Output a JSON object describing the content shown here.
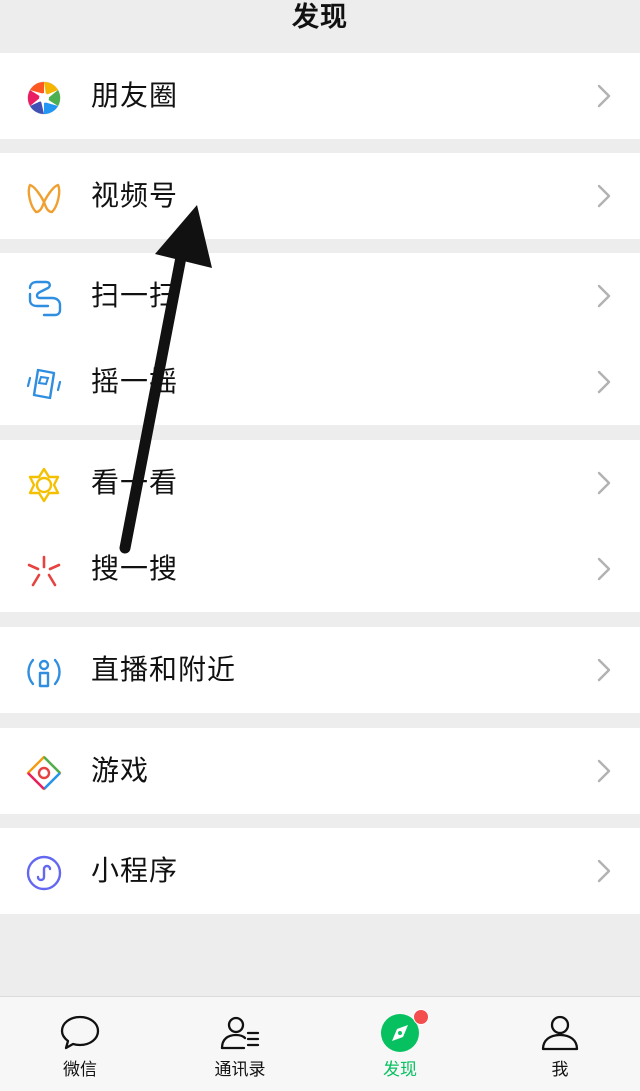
{
  "header": {
    "title": "发现"
  },
  "items": {
    "moments": "朋友圈",
    "channels": "视频号",
    "scan": "扫一扫",
    "shake": "摇一摇",
    "top_stories": "看一看",
    "search": "搜一搜",
    "live_nearby": "直播和附近",
    "games": "游戏",
    "mini_programs": "小程序"
  },
  "tabbar": {
    "chats": "微信",
    "contacts": "通讯录",
    "discover": "发现",
    "me": "我"
  },
  "colors": {
    "accent": "#07c160",
    "badge": "#f44d4d",
    "background": "#ededed"
  }
}
